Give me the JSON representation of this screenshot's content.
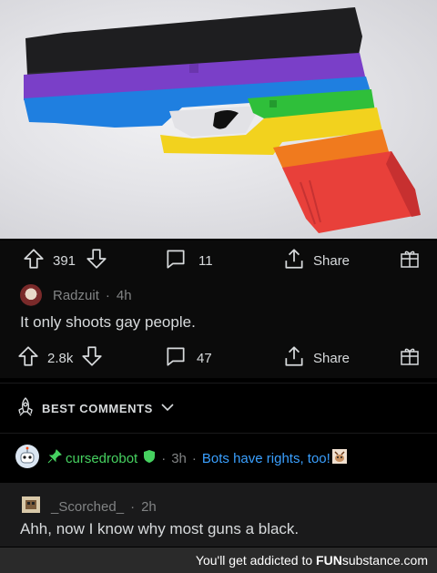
{
  "post": {
    "upvotes": "391",
    "comments": "11",
    "share_label": "Share"
  },
  "comment1": {
    "author": "Radzuit",
    "age": "4h",
    "body": "It only shoots gay people.",
    "upvotes": "2.8k",
    "replies": "47",
    "share_label": "Share"
  },
  "best_comments": {
    "label": "BEST COMMENTS"
  },
  "bot_comment": {
    "author": "cursedrobot",
    "age": "3h",
    "flair": "Bots have rights, too!"
  },
  "comment2": {
    "author": "_Scorched_",
    "age": "2h",
    "body": "Ahh, now I know why most guns a black."
  },
  "watermark": {
    "prefix": "You'll get addicted to",
    "brand_bold": "FUN",
    "brand_rest": "substance.com"
  },
  "colors": {
    "username_green": "#46d160",
    "flair_blue": "#3aa0ff",
    "panel": "#0b0b0b",
    "text": "#d7dadc",
    "meta": "#818384"
  }
}
